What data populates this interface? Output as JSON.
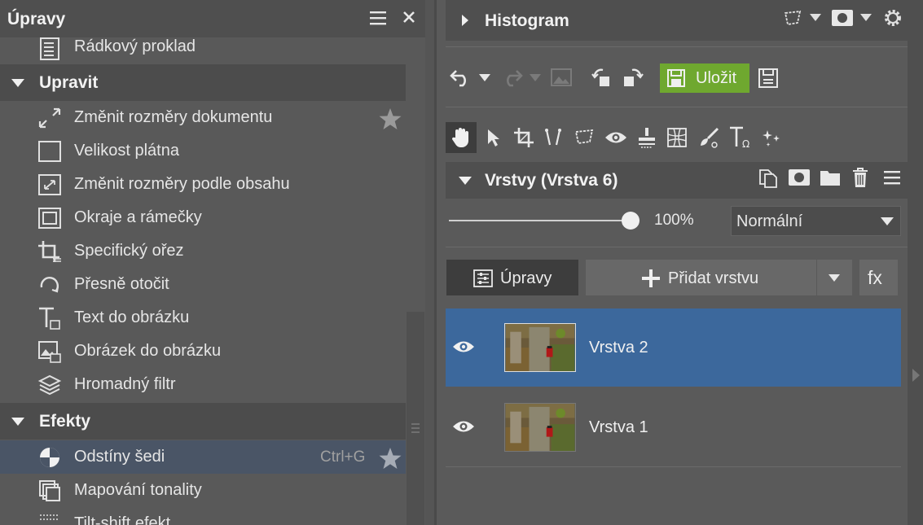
{
  "left_panel": {
    "title": "Úpravy",
    "top_item": {
      "label": "Rádkový proklad",
      "icon": "line-spacing-icon"
    },
    "sections": [
      {
        "title": "Upravit",
        "items": [
          {
            "label": "Změnit rozměry dokumentu",
            "icon": "resize-document-icon",
            "favorite": true
          },
          {
            "label": "Velikost plátna",
            "icon": "canvas-size-icon"
          },
          {
            "label": "Změnit rozměry podle obsahu",
            "icon": "fit-to-content-icon"
          },
          {
            "label": "Okraje a rámečky",
            "icon": "borders-frames-icon"
          },
          {
            "label": "Specifický ořez",
            "icon": "crop-icon"
          },
          {
            "label": "Přesně otočit",
            "icon": "rotate-icon"
          },
          {
            "label": "Text do obrázku",
            "icon": "text-tool-icon"
          },
          {
            "label": "Obrázek do obrázku",
            "icon": "image-in-image-icon"
          },
          {
            "label": "Hromadný filtr",
            "icon": "batch-filter-icon"
          }
        ]
      },
      {
        "title": "Efekty",
        "items": [
          {
            "label": "Odstíny šedi",
            "icon": "grayscale-icon",
            "shortcut": "Ctrl+G",
            "favorite": true,
            "highlighted": true
          },
          {
            "label": "Mapování tonality",
            "icon": "tone-mapping-icon"
          },
          {
            "label": "Tilt-shift efekt",
            "icon": "tilt-shift-icon"
          }
        ]
      }
    ]
  },
  "histogram": {
    "title": "Histogram"
  },
  "toolbar": {
    "save_label": "Uložit"
  },
  "layers": {
    "title": "Vrstvy (Vrstva 6)",
    "opacity": "100%",
    "opacity_value": 1.0,
    "blend_mode": "Normální",
    "adjustments_label": "Úpravy",
    "add_layer_label": "Přidat vrstvu",
    "fx_label": "fx",
    "items": [
      {
        "name": "Vrstva 2",
        "visible": true,
        "selected": true
      },
      {
        "name": "Vrstva 1",
        "visible": true,
        "selected": false
      }
    ]
  },
  "colors": {
    "selection": "#3c689c",
    "save_button": "#6fa82f",
    "highlight_row": "#4a5566"
  }
}
